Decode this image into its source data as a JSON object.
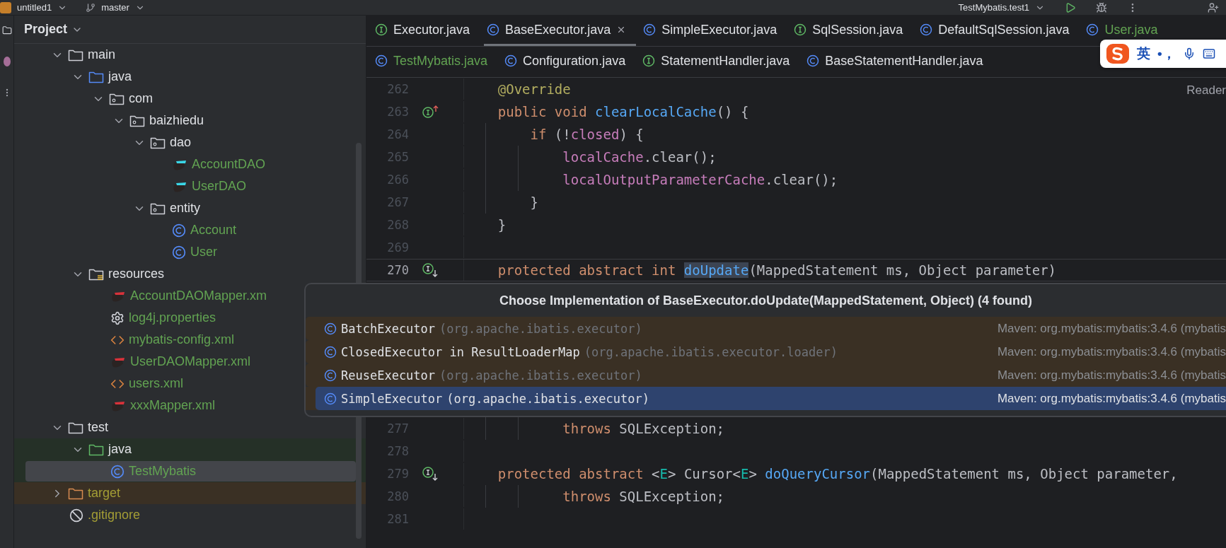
{
  "top_bar": {
    "project": "untitled1",
    "branch": "master",
    "run_config": "TestMybatis.test1"
  },
  "project_panel": {
    "title": "Project",
    "tree": [
      {
        "label": "main",
        "kind": "folder",
        "expanded": true,
        "selected": false,
        "children": [
          {
            "label": "java",
            "kind": "source-folder",
            "expanded": true,
            "selected": false,
            "children": [
              {
                "label": "com",
                "kind": "package",
                "expanded": true,
                "selected": false,
                "children": [
                  {
                    "label": "baizhiedu",
                    "kind": "package",
                    "expanded": true,
                    "selected": false,
                    "children": [
                      {
                        "label": "dao",
                        "kind": "package",
                        "expanded": true,
                        "selected": false,
                        "children": [
                          {
                            "label": "AccountDAO",
                            "kind": "mybatis-java",
                            "color": "#62a352",
                            "selected": false
                          },
                          {
                            "label": "UserDAO",
                            "kind": "mybatis-java",
                            "color": "#62a352",
                            "selected": false
                          }
                        ]
                      },
                      {
                        "label": "entity",
                        "kind": "package",
                        "expanded": true,
                        "selected": false,
                        "children": [
                          {
                            "label": "Account",
                            "kind": "class",
                            "color": "#62a352",
                            "selected": false
                          },
                          {
                            "label": "User",
                            "kind": "class",
                            "color": "#62a352",
                            "selected": false
                          }
                        ]
                      }
                    ]
                  }
                ]
              }
            ]
          },
          {
            "label": "resources",
            "kind": "resources-folder",
            "expanded": true,
            "selected": false,
            "children": [
              {
                "label": "AccountDAOMapper.xm",
                "kind": "mybatis-xml",
                "color": "#62a352",
                "selected": false
              },
              {
                "label": "log4j.properties",
                "kind": "properties",
                "color": "#62a352",
                "selected": false
              },
              {
                "label": "mybatis-config.xml",
                "kind": "xml",
                "color": "#62a352",
                "selected": false
              },
              {
                "label": "UserDAOMapper.xml",
                "kind": "mybatis-xml",
                "color": "#62a352",
                "selected": false
              },
              {
                "label": "users.xml",
                "kind": "xml",
                "color": "#62a352",
                "selected": false
              },
              {
                "label": "xxxMapper.xml",
                "kind": "mybatis-xml",
                "color": "#62a352",
                "selected": false
              }
            ]
          }
        ]
      },
      {
        "label": "test",
        "kind": "folder",
        "expanded": true,
        "selected": false,
        "children": [
          {
            "label": "java",
            "kind": "test-folder",
            "expanded": true,
            "selected": false,
            "children": [
              {
                "label": "TestMybatis",
                "kind": "class",
                "color": "#62a352",
                "selected": true
              }
            ]
          }
        ]
      },
      {
        "label": "target",
        "kind": "excluded-folder",
        "expanded": false,
        "color": "#a39d35",
        "selected": false
      },
      {
        "label": ".gitignore",
        "kind": "ignored",
        "color": "#a39d35",
        "selected": false
      }
    ]
  },
  "editor": {
    "tab_rows": [
      {
        "tabs": [
          {
            "label": "Executor.java",
            "kind": "interface",
            "selected": false
          },
          {
            "label": "BaseExecutor.java",
            "kind": "class",
            "selected": true
          },
          {
            "label": "SimpleExecutor.java",
            "kind": "class",
            "selected": false
          },
          {
            "label": "SqlSession.java",
            "kind": "interface",
            "selected": false
          },
          {
            "label": "DefaultSqlSession.java",
            "kind": "class",
            "selected": false
          },
          {
            "label": "User.java",
            "kind": "class",
            "color": "#62a352",
            "selected": false
          }
        ]
      },
      {
        "tabs": [
          {
            "label": "TestMybatis.java",
            "kind": "class",
            "color": "#62a352",
            "selected": false
          },
          {
            "label": "Configuration.java",
            "kind": "class",
            "selected": false
          },
          {
            "label": "StatementHandler.java",
            "kind": "interface",
            "selected": false
          },
          {
            "label": "BaseStatementHandler.java",
            "kind": "class",
            "selected": false
          }
        ]
      }
    ],
    "reader_mode": "Reader",
    "lines_before": [
      {
        "number": "262",
        "kind": "plain",
        "current": false,
        "tokens": [
          {
            "text": "    @Override",
            "kind": "annotation"
          }
        ]
      },
      {
        "number": "263",
        "kind": "overrides",
        "current": false,
        "tokens": [
          {
            "text": "    public void ",
            "kind": "keyword"
          },
          {
            "text": "clearLocalCache",
            "kind": "method"
          },
          {
            "text": "() {",
            "kind": "plain"
          }
        ]
      },
      {
        "number": "264",
        "kind": "plain",
        "current": false,
        "tokens": [
          {
            "text": "        if ",
            "kind": "keyword"
          },
          {
            "text": "(!",
            "kind": "plain"
          },
          {
            "text": "closed",
            "kind": "field"
          },
          {
            "text": ") {",
            "kind": "plain"
          }
        ]
      },
      {
        "number": "265",
        "kind": "plain",
        "current": false,
        "tokens": [
          {
            "text": "            localCache",
            "kind": "field"
          },
          {
            "text": ".clear();",
            "kind": "plain"
          }
        ]
      },
      {
        "number": "266",
        "kind": "plain",
        "current": false,
        "tokens": [
          {
            "text": "            localOutputParameterCache",
            "kind": "field"
          },
          {
            "text": ".clear();",
            "kind": "plain"
          }
        ]
      },
      {
        "number": "267",
        "kind": "plain",
        "current": false,
        "tokens": [
          {
            "text": "        }",
            "kind": "plain"
          }
        ]
      },
      {
        "number": "268",
        "kind": "plain",
        "current": false,
        "tokens": [
          {
            "text": "    }",
            "kind": "plain"
          }
        ]
      },
      {
        "number": "269",
        "kind": "plain",
        "current": false
      },
      {
        "number": "270",
        "kind": "implemented",
        "current": true,
        "tokens": [
          {
            "text": "    protected abstract int ",
            "kind": "keyword"
          },
          {
            "text": "doUpdate",
            "kind": "usage"
          },
          {
            "text": "(MappedStatement ms, Object parameter)",
            "kind": "plain"
          }
        ]
      }
    ],
    "lines_after": [
      {
        "number": "277",
        "kind": "plain",
        "current": false,
        "tokens": [
          {
            "text": "            throws ",
            "kind": "keyword"
          },
          {
            "text": "SQLException;",
            "kind": "plain"
          }
        ]
      },
      {
        "number": "278",
        "kind": "plain",
        "current": false
      },
      {
        "number": "279",
        "kind": "implemented",
        "current": false,
        "tokens": [
          {
            "text": "    protected abstract ",
            "kind": "keyword"
          },
          {
            "text": "<",
            "kind": "plain"
          },
          {
            "text": "E",
            "kind": "typeparam"
          },
          {
            "text": "> Cursor<",
            "kind": "plain"
          },
          {
            "text": "E",
            "kind": "typeparam"
          },
          {
            "text": "> ",
            "kind": "plain"
          },
          {
            "text": "doQueryCursor",
            "kind": "method"
          },
          {
            "text": "(MappedStatement ms, Object parameter,",
            "kind": "plain"
          }
        ]
      },
      {
        "number": "280",
        "kind": "plain",
        "current": false,
        "tokens": [
          {
            "text": "            throws ",
            "kind": "keyword"
          },
          {
            "text": "SQLException;",
            "kind": "plain"
          }
        ]
      },
      {
        "number": "281",
        "kind": "plain",
        "current": false
      }
    ]
  },
  "popup": {
    "title": "Choose Implementation of BaseExecutor.doUpdate(MappedStatement, Object) (4 found)",
    "items": [
      {
        "name": "BatchExecutor",
        "package": "(org.apache.ibatis.executor)",
        "library": "Maven: org.mybatis:mybatis:3.4.6 (mybatis",
        "selected": false
      },
      {
        "name": "ClosedExecutor in ResultLoaderMap",
        "package": "(org.apache.ibatis.executor.loader)",
        "library": "Maven: org.mybatis:mybatis:3.4.6 (mybatis",
        "selected": false
      },
      {
        "name": "ReuseExecutor",
        "package": "(org.apache.ibatis.executor)",
        "library": "Maven: org.mybatis:mybatis:3.4.6 (mybatis",
        "selected": false
      },
      {
        "name": "SimpleExecutor",
        "package": "(org.apache.ibatis.executor)",
        "library": "Maven: org.mybatis:mybatis:3.4.6 (mybatis",
        "selected": true
      }
    ]
  },
  "ime_bar": {
    "language": "英",
    "punctuation": "•，"
  }
}
